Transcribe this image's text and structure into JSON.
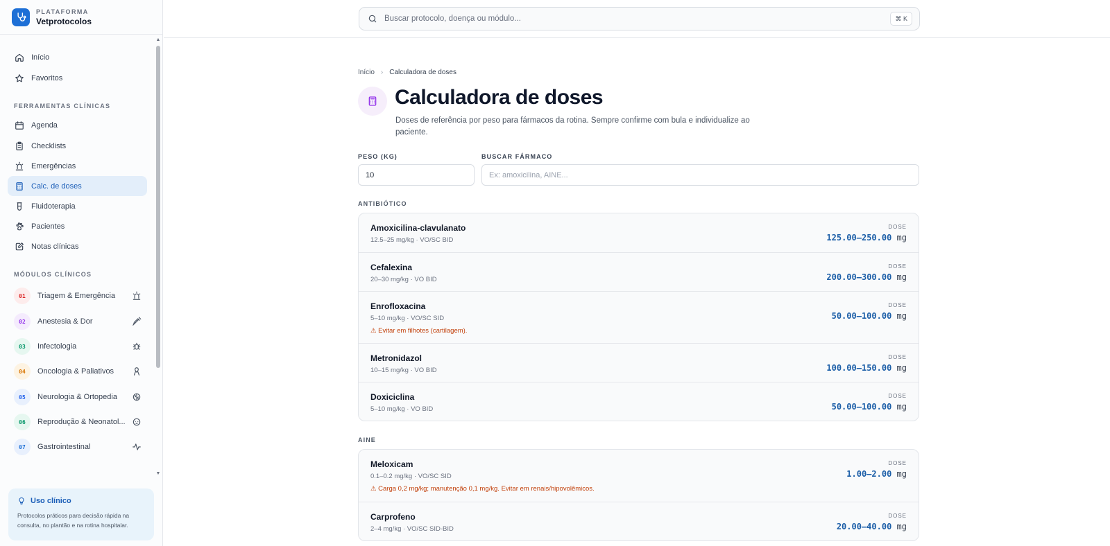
{
  "brand": {
    "kicker": "PLATAFORMA",
    "name": "Vetprotocolos"
  },
  "sidebar": {
    "top_items": [
      {
        "label": "Início",
        "icon": "home-icon"
      },
      {
        "label": "Favoritos",
        "icon": "star-icon"
      }
    ],
    "tools_label": "FERRAMENTAS CLÍNICAS",
    "tools": [
      {
        "label": "Agenda",
        "icon": "calendar-icon"
      },
      {
        "label": "Checklists",
        "icon": "clipboard-icon"
      },
      {
        "label": "Emergências",
        "icon": "siren-icon"
      },
      {
        "label": "Calc. de doses",
        "icon": "calculator-icon",
        "active": true
      },
      {
        "label": "Fluidoterapia",
        "icon": "fluid-bag-icon"
      },
      {
        "label": "Pacientes",
        "icon": "paw-icon"
      },
      {
        "label": "Notas clínicas",
        "icon": "notes-icon"
      }
    ],
    "modules_label": "MÓDULOS CLÍNICOS",
    "modules": [
      {
        "num": "01",
        "label": "Triagem & Emergência",
        "color": "#dc2626",
        "bg": "#fdecec",
        "icon": "siren-icon"
      },
      {
        "num": "02",
        "label": "Anestesia & Dor",
        "color": "#9333ea",
        "bg": "#f4ebfd",
        "icon": "syringe-icon"
      },
      {
        "num": "03",
        "label": "Infectologia",
        "color": "#059669",
        "bg": "#e6f7f0",
        "icon": "bug-icon"
      },
      {
        "num": "04",
        "label": "Oncologia & Paliativos",
        "color": "#d97706",
        "bg": "#fdf3e2",
        "icon": "ribbon-icon"
      },
      {
        "num": "05",
        "label": "Neurologia & Ortopedia",
        "color": "#2563eb",
        "bg": "#e8f0fd",
        "icon": "brain-icon"
      },
      {
        "num": "06",
        "label": "Reprodução & Neonatol...",
        "color": "#059669",
        "bg": "#e6f7f0",
        "icon": "baby-icon"
      },
      {
        "num": "07",
        "label": "Gastrointestinal",
        "color": "#1d6fd6",
        "bg": "#e8f0fd",
        "icon": "activity-icon"
      }
    ],
    "usage": {
      "title": "Uso clínico",
      "text": "Protocolos práticos para decisão rápida na consulta, no plantão e na rotina hospitalar."
    }
  },
  "search": {
    "placeholder": "Buscar protocolo, doença ou módulo...",
    "shortcut": "⌘ K"
  },
  "breadcrumb": {
    "home": "Início",
    "current": "Calculadora de doses"
  },
  "page": {
    "title": "Calculadora de doses",
    "description": "Doses de referência por peso para fármacos da rotina. Sempre confirme com bula e individualize ao paciente."
  },
  "form": {
    "weight_label": "PESO (KG)",
    "weight_value": "10",
    "drug_search_label": "BUSCAR FÁRMACO",
    "drug_search_placeholder": "Ex: amoxicilina, AINE..."
  },
  "dose_label": "DOSE",
  "dose_unit": "mg",
  "groups": [
    {
      "label": "ANTIBIÓTICO",
      "drugs": [
        {
          "name": "Amoxicilina-clavulanato",
          "dose": "12.5–25 mg/kg · VO/SC BID",
          "result": "125.00–250.00"
        },
        {
          "name": "Cefalexina",
          "dose": "20–30 mg/kg · VO BID",
          "result": "200.00–300.00"
        },
        {
          "name": "Enrofloxacina",
          "dose": "5–10 mg/kg · VO/SC SID",
          "result": "50.00–100.00",
          "warning": "⚠ Evitar em filhotes (cartilagem)."
        },
        {
          "name": "Metronidazol",
          "dose": "10–15 mg/kg · VO BID",
          "result": "100.00–150.00"
        },
        {
          "name": "Doxiciclina",
          "dose": "5–10 mg/kg · VO BID",
          "result": "50.00–100.00"
        }
      ]
    },
    {
      "label": "AINE",
      "drugs": [
        {
          "name": "Meloxicam",
          "dose": "0.1–0.2 mg/kg · VO/SC SID",
          "result": "1.00–2.00",
          "warning": "⚠ Carga 0,2 mg/kg; manutenção 0,1 mg/kg. Evitar em renais/hipovolêmicos."
        },
        {
          "name": "Carprofeno",
          "dose": "2–4 mg/kg · VO/SC SID-BID",
          "result": "20.00–40.00"
        }
      ]
    }
  ]
}
